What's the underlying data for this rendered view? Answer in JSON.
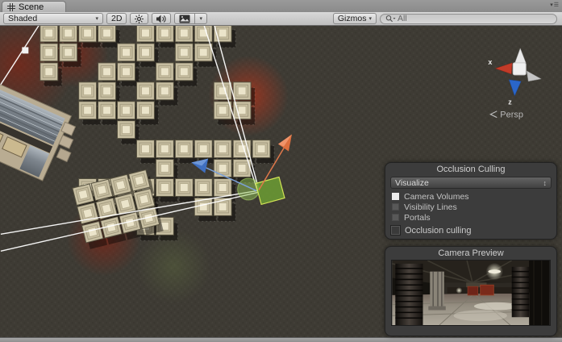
{
  "window": {
    "tab_label": "Scene"
  },
  "toolbar": {
    "shading_mode": "Shaded",
    "btn_2d": "2D",
    "gizmos_label": "Gizmos",
    "search_value": "All"
  },
  "scene": {
    "persp_label": "Persp",
    "axis_x_label": "x",
    "axis_z_label": "z"
  },
  "occlusion": {
    "title": "Occlusion Culling",
    "dropdown_value": "Visualize",
    "items": [
      {
        "label": "Camera Volumes",
        "checked": true
      },
      {
        "label": "Visibility Lines",
        "checked": false
      },
      {
        "label": "Portals",
        "checked": false
      }
    ],
    "toggle_label": "Occlusion culling",
    "toggle_checked": false
  },
  "camera_preview": {
    "title": "Camera Preview"
  },
  "colors": {
    "move_axis_x": "#e0703d",
    "move_axis_z": "#4f7fd0",
    "selection_green": "#9ccb3c",
    "orientation_x": "#c33b28",
    "orientation_z": "#2a66c9",
    "frustum_line": "#ffffff",
    "scene_background": "#3e3b34"
  }
}
